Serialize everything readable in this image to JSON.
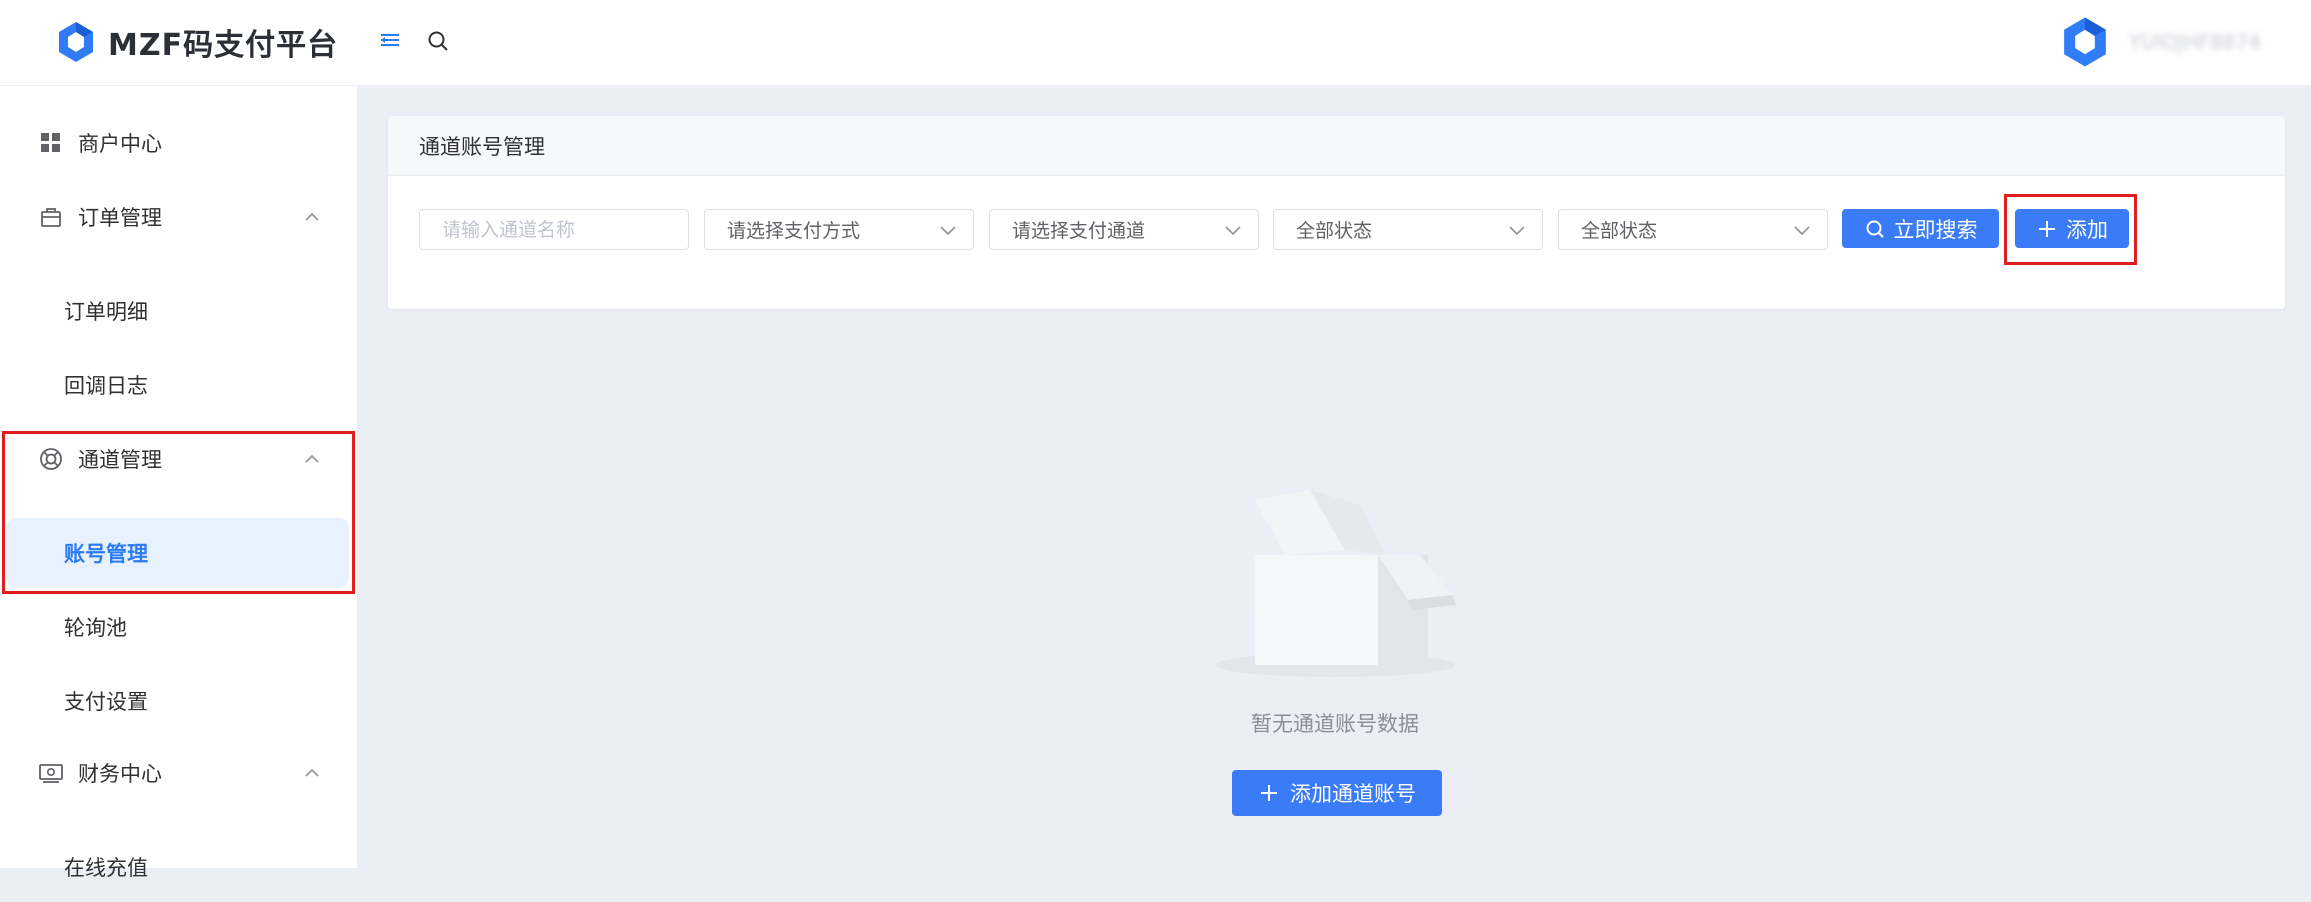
{
  "app": {
    "title": "MZF码支付平台"
  },
  "header": {
    "username": "YUIOJHF8874"
  },
  "sidebar": {
    "groups": [
      {
        "label": "商户中心",
        "icon": "grid-icon"
      },
      {
        "label": "订单管理",
        "icon": "bag-icon",
        "expanded": true
      },
      {
        "label": "通道管理",
        "icon": "lifebuoy-icon",
        "expanded": true
      },
      {
        "label": "财务中心",
        "icon": "wallet-icon",
        "expanded": true
      }
    ],
    "items": [
      {
        "label": "订单明细"
      },
      {
        "label": "回调日志"
      },
      {
        "label": "账号管理",
        "active": true
      },
      {
        "label": "轮询池"
      },
      {
        "label": "支付设置"
      },
      {
        "label": "在线充值"
      }
    ]
  },
  "page": {
    "title": "通道账号管理",
    "filters": {
      "name_placeholder": "请输入通道名称",
      "pay_method": "请选择支付方式",
      "pay_channel": "请选择支付通道",
      "status1": "全部状态",
      "status2": "全部状态"
    },
    "search_button": "立即搜索",
    "add_button": "添加"
  },
  "empty": {
    "text": "暂无通道账号数据",
    "button": "添加通道账号"
  },
  "colors": {
    "primary": "#3a7bf7",
    "active_bg": "#e8f2ff",
    "highlight": "#e01e1e"
  }
}
